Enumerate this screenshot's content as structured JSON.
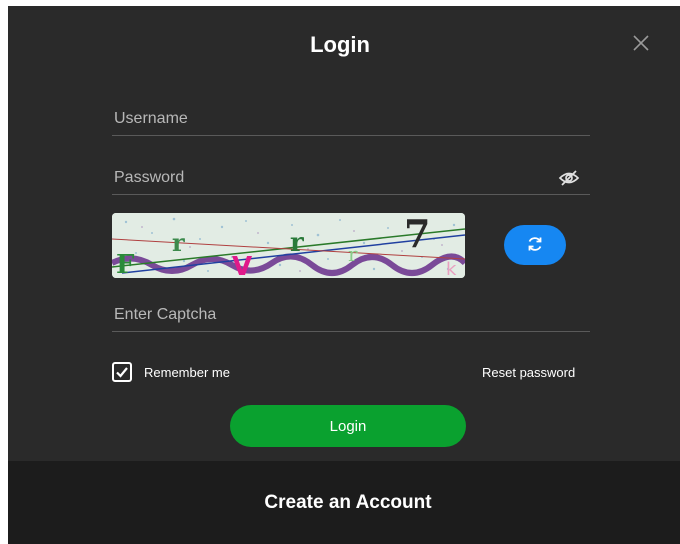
{
  "dialog": {
    "title": "Login",
    "close_icon": "close-icon"
  },
  "form": {
    "username_placeholder": "Username",
    "password_placeholder": "Password",
    "password_toggle_icon": "eye-off-icon",
    "captcha_placeholder": "Enter Captcha",
    "captcha_refresh_icon": "refresh-icon",
    "captcha_characters": [
      "F",
      "r",
      "r",
      "V",
      "7",
      "r",
      "k"
    ]
  },
  "options": {
    "remember_label": "Remember me",
    "remember_checked": true,
    "reset_label": "Reset password"
  },
  "actions": {
    "login_label": "Login",
    "create_account_label": "Create an Account"
  },
  "colors": {
    "background": "#2a2a2a",
    "footer_background": "#1c1c1c",
    "primary_green": "#0aa12f",
    "refresh_blue": "#1687f2"
  }
}
